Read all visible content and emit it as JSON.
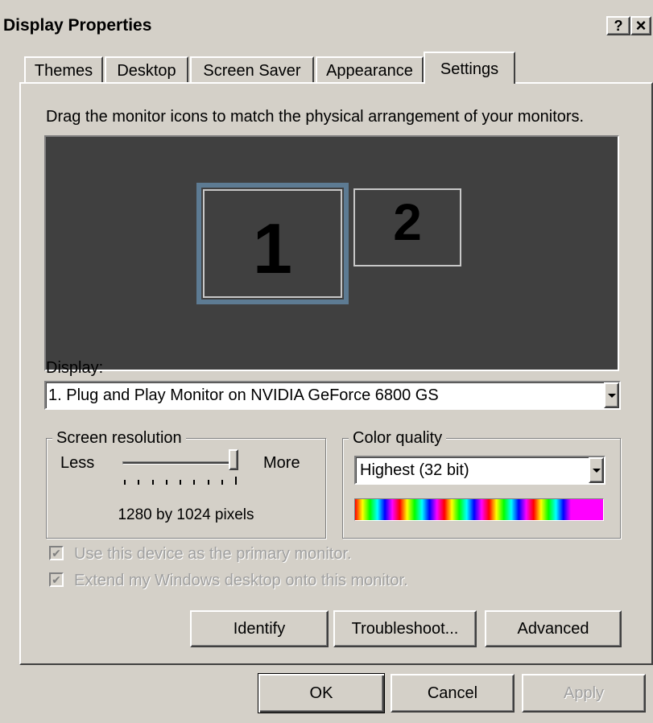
{
  "window": {
    "title": "Display Properties",
    "help_label": "?",
    "close_label": "×"
  },
  "tabs": [
    {
      "label": "Themes",
      "active": false
    },
    {
      "label": "Desktop",
      "active": false
    },
    {
      "label": "Screen Saver",
      "active": false
    },
    {
      "label": "Appearance",
      "active": false
    },
    {
      "label": "Settings",
      "active": true
    }
  ],
  "settings": {
    "instruction": "Drag the monitor icons to match the physical arrangement of your monitors.",
    "monitors": [
      {
        "number": "1",
        "selected": true
      },
      {
        "number": "2",
        "selected": false
      }
    ],
    "display_label": "Display:",
    "display_value": "1. Plug and Play Monitor on NVIDIA GeForce 6800 GS",
    "resolution": {
      "legend": "Screen resolution",
      "less_label": "Less",
      "more_label": "More",
      "value_text": "1280 by 1024 pixels",
      "slider_position": 1.0
    },
    "color_quality": {
      "legend": "Color quality",
      "value": "Highest (32 bit)"
    },
    "checkboxes": [
      {
        "label": "Use this device as the primary monitor.",
        "checked": true,
        "disabled": true
      },
      {
        "label": "Extend my Windows desktop onto this monitor.",
        "checked": true,
        "disabled": true
      }
    ],
    "buttons": {
      "identify": "Identify",
      "troubleshoot": "Troubleshoot...",
      "advanced": "Advanced"
    }
  },
  "footer": {
    "ok": "OK",
    "cancel": "Cancel",
    "apply": "Apply"
  },
  "colors": {
    "face": "#d4d0c8",
    "monitor_area": "#404040",
    "selected_monitor_border": "#5d7b93"
  }
}
